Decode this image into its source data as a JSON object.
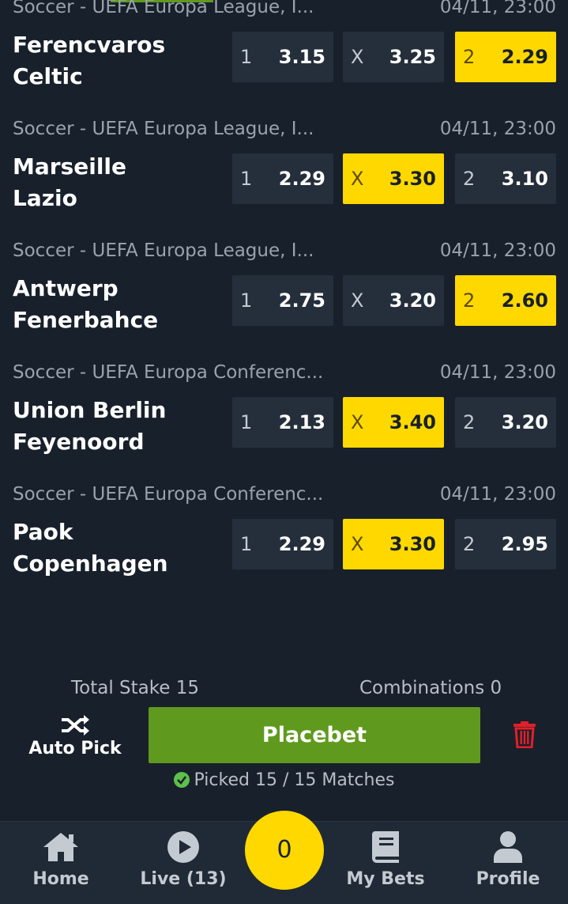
{
  "matches": [
    {
      "league": "Soccer - UEFA Europa League, I...",
      "time": "04/11, 23:00",
      "home": "Ferencvaros",
      "away": "Celtic",
      "odds": [
        {
          "label": "1",
          "value": "3.15",
          "selected": false
        },
        {
          "label": "X",
          "value": "3.25",
          "selected": false
        },
        {
          "label": "2",
          "value": "2.29",
          "selected": true
        }
      ]
    },
    {
      "league": "Soccer - UEFA Europa League, I...",
      "time": "04/11, 23:00",
      "home": "Marseille",
      "away": "Lazio",
      "odds": [
        {
          "label": "1",
          "value": "2.29",
          "selected": false
        },
        {
          "label": "X",
          "value": "3.30",
          "selected": true
        },
        {
          "label": "2",
          "value": "3.10",
          "selected": false
        }
      ]
    },
    {
      "league": "Soccer - UEFA Europa League, I...",
      "time": "04/11, 23:00",
      "home": "Antwerp",
      "away": "Fenerbahce",
      "odds": [
        {
          "label": "1",
          "value": "2.75",
          "selected": false
        },
        {
          "label": "X",
          "value": "3.20",
          "selected": false
        },
        {
          "label": "2",
          "value": "2.60",
          "selected": true
        }
      ]
    },
    {
      "league": "Soccer - UEFA Europa Conferenc...",
      "time": "04/11, 23:00",
      "home": "Union Berlin",
      "away": "Feyenoord",
      "odds": [
        {
          "label": "1",
          "value": "2.13",
          "selected": false
        },
        {
          "label": "X",
          "value": "3.40",
          "selected": true
        },
        {
          "label": "2",
          "value": "3.20",
          "selected": false
        }
      ]
    },
    {
      "league": "Soccer - UEFA Europa Conferenc...",
      "time": "04/11, 23:00",
      "home": "Paok",
      "away": "Copenhagen",
      "odds": [
        {
          "label": "1",
          "value": "2.29",
          "selected": false
        },
        {
          "label": "X",
          "value": "3.30",
          "selected": true
        },
        {
          "label": "2",
          "value": "2.95",
          "selected": false
        }
      ]
    }
  ],
  "betslip_bar": {
    "total_stake": "Total Stake 15",
    "combinations": "Combinations 0",
    "autopick_label": "Auto Pick",
    "placebet_label": "Placebet",
    "picked_text": "Picked 15 / 15 Matches"
  },
  "bottom_nav": {
    "home": "Home",
    "live": "Live (13)",
    "betslip_count": "0",
    "my_bets": "My Bets",
    "profile": "Profile"
  },
  "colors": {
    "background": "#18202b",
    "odd_bg": "#252f3b",
    "selected": "#ffd800",
    "placebet": "#5f9a1e",
    "delete": "#e0202a",
    "check": "#5cc04a"
  },
  "icons": {
    "autopick": "shuffle-icon",
    "delete": "trash-icon",
    "picked": "check-circle-icon",
    "home": "home-icon",
    "live": "play-circle-icon",
    "my_bets": "book-icon",
    "profile": "user-icon"
  }
}
